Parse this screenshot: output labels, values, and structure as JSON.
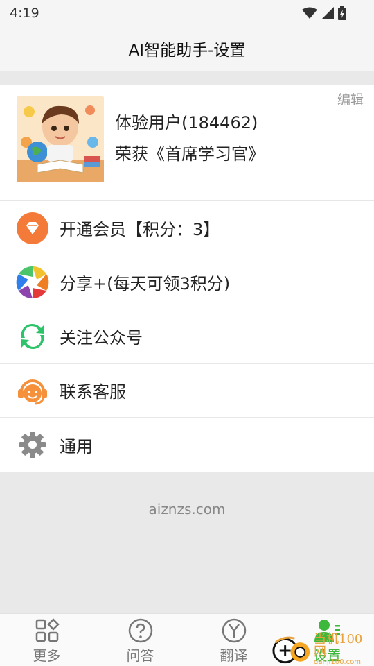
{
  "status": {
    "time": "4:19"
  },
  "header": {
    "title": "AI智能助手-设置"
  },
  "profile": {
    "edit_label": "编辑",
    "name": "体验用户(184462)",
    "honor": "荣获《首席学习官》"
  },
  "menu": [
    {
      "label": "开通会员【积分：3】",
      "icon": "diamond-icon"
    },
    {
      "label": "分享+(每天可领3积分)",
      "icon": "share-aperture-icon"
    },
    {
      "label": "关注公众号",
      "icon": "official-account-icon"
    },
    {
      "label": "联系客服",
      "icon": "customer-service-icon"
    },
    {
      "label": "通用",
      "icon": "gear-icon"
    }
  ],
  "footer": {
    "url": "aiznzs.com"
  },
  "nav": [
    {
      "label": "更多",
      "icon": "grid-icon"
    },
    {
      "label": "问答",
      "icon": "question-icon"
    },
    {
      "label": "翻译",
      "icon": "translate-icon"
    },
    {
      "label": "设置",
      "icon": "user-settings-icon"
    }
  ],
  "watermark": {
    "text": "当机100网",
    "sub": "danji100.com"
  },
  "colors": {
    "active": "#3db83a",
    "accent_orange": "#f47a3a",
    "accent_green": "#2cc36b"
  }
}
